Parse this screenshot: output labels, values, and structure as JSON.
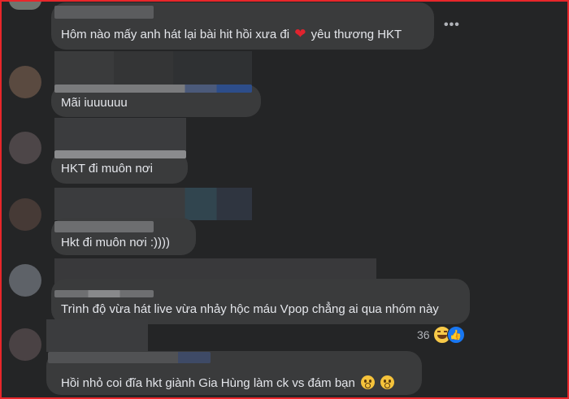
{
  "comments": [
    {
      "text_before": "Hôm nào mấy anh hát lại bài hit hồi xưa đi",
      "text_after": "yêu thương HKT"
    },
    {
      "text": "Mãi iuuuuuu"
    },
    {
      "text": "HKT đi muôn nơi"
    },
    {
      "text": "Hkt đi muôn nơi :))))"
    },
    {
      "text": "Trình độ vừa hát live vừa nhảy hộc máu Vpop chẳng ai qua nhóm này",
      "reaction_count": "36"
    },
    {
      "text": "Hồi nhỏ coi đĩa hkt giành Gia Hùng làm ck vs đám bạn"
    }
  ],
  "more_options": "•••",
  "icons": {
    "heart": "heart-icon",
    "laugh": "laugh-reaction-icon",
    "like": "like-reaction-icon",
    "flushed": "flushed-face-emoji"
  },
  "colors": {
    "background": "#242526",
    "bubble": "#3a3b3c",
    "text": "#e4e6eb",
    "frame": "#e8262a",
    "like": "#1877f2"
  }
}
